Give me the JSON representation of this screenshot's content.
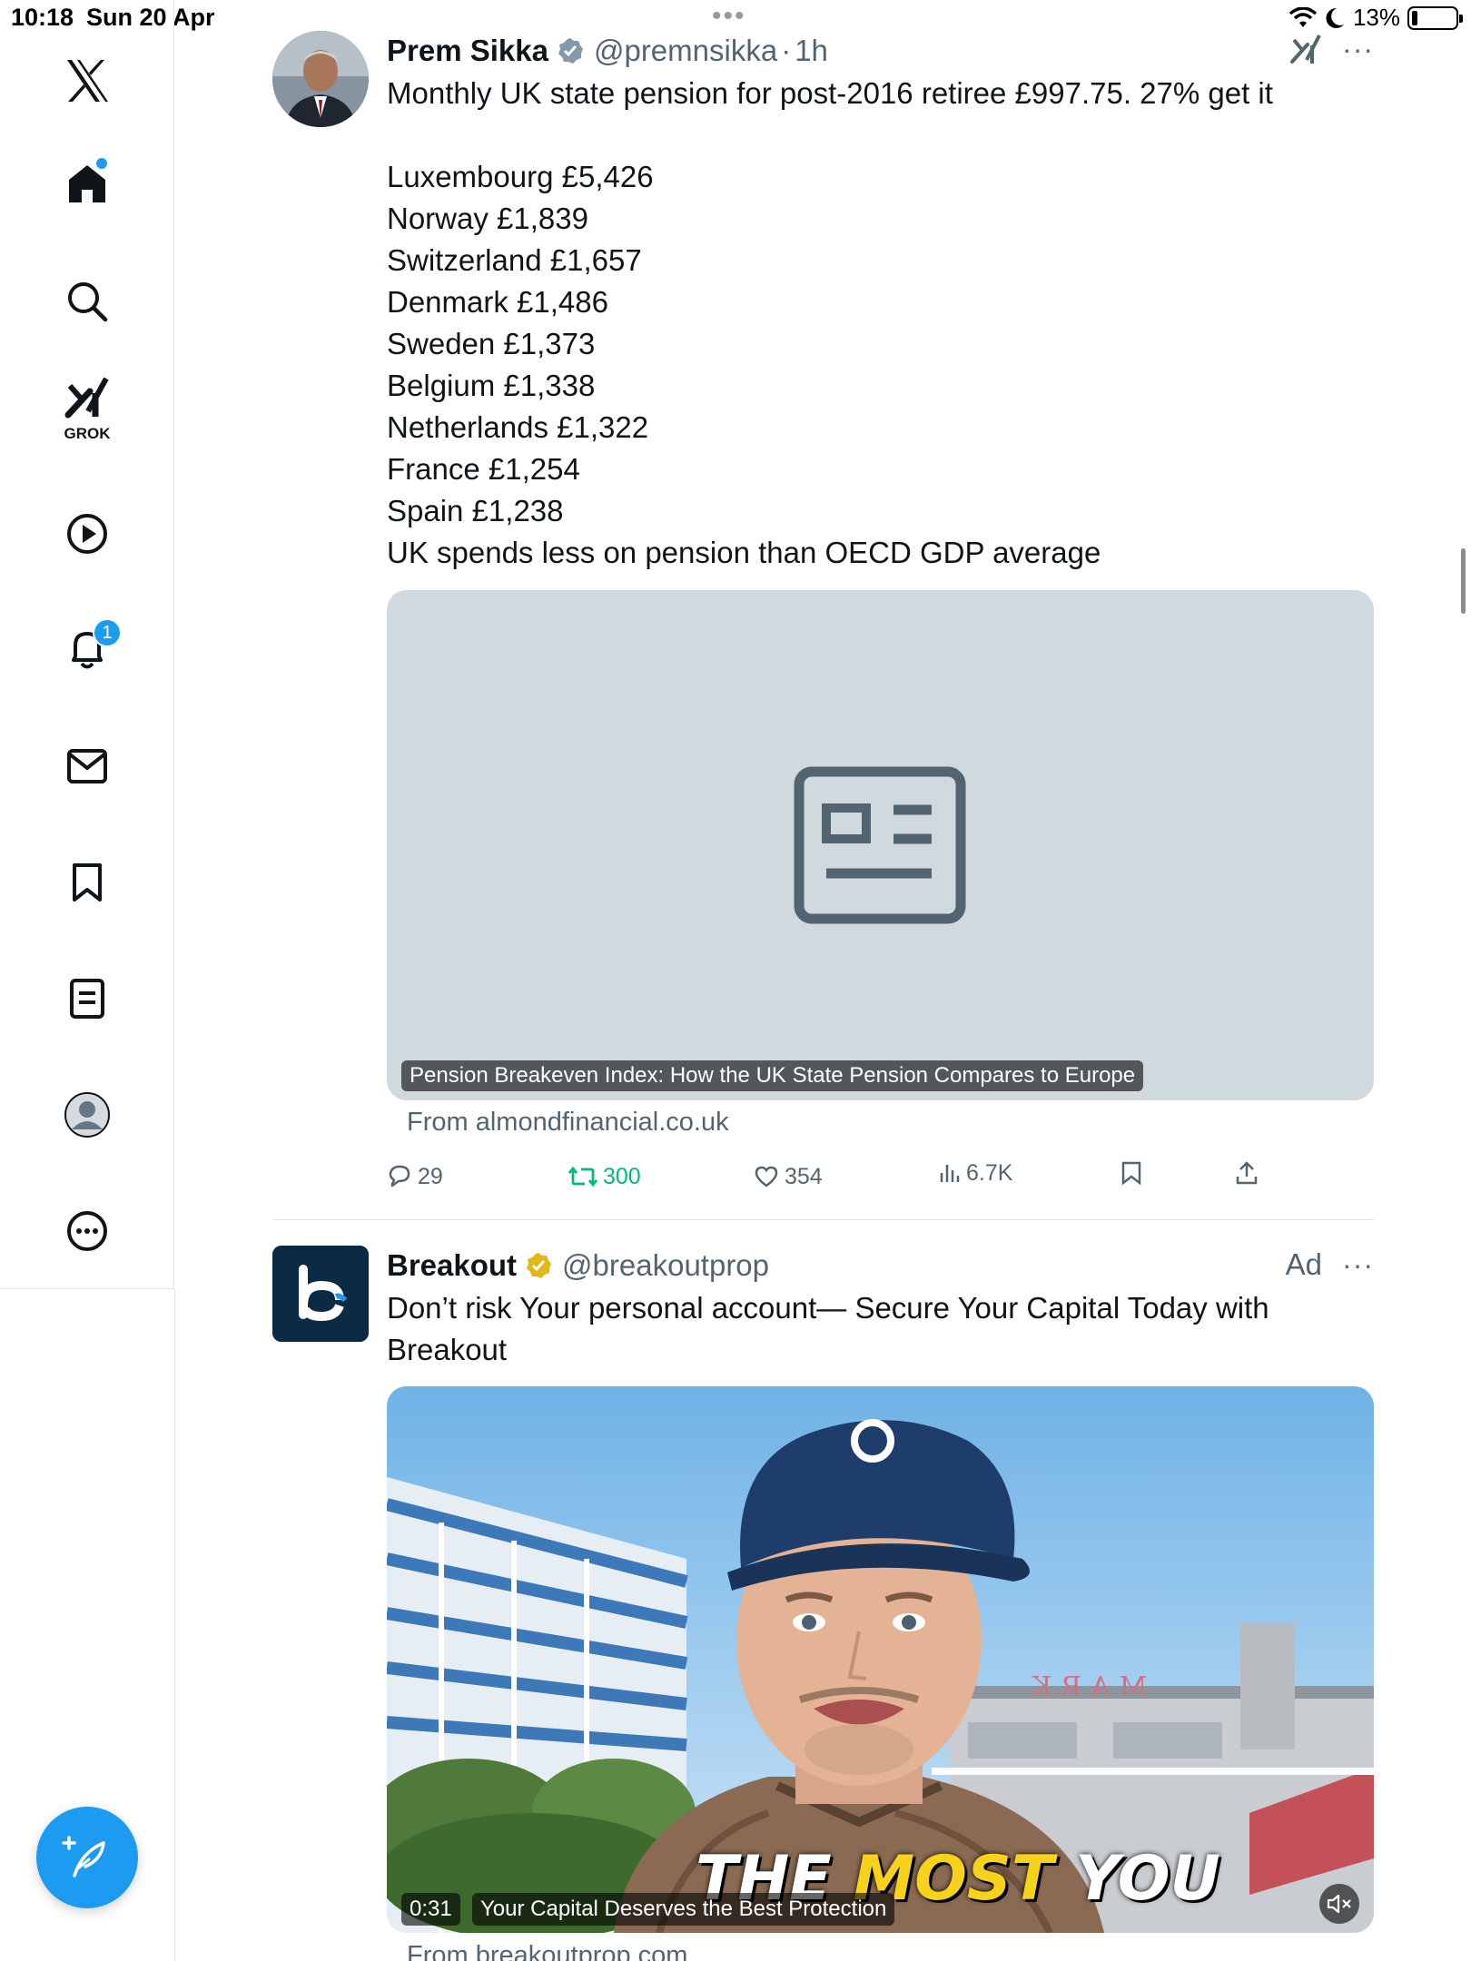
{
  "status_bar": {
    "time": "10:18",
    "date": "Sun 20 Apr",
    "battery": "13%"
  },
  "sidebar": {
    "items": [
      {
        "name": "home",
        "icon": "home-icon"
      },
      {
        "name": "search",
        "icon": "search-icon"
      },
      {
        "name": "grok",
        "icon": "grok-icon",
        "label": "GROK"
      },
      {
        "name": "video",
        "icon": "play-icon"
      },
      {
        "name": "notifications",
        "icon": "bell-icon",
        "badge": "1"
      },
      {
        "name": "messages",
        "icon": "mail-icon"
      },
      {
        "name": "bookmarks",
        "icon": "bookmark-icon"
      },
      {
        "name": "lists",
        "icon": "list-icon"
      },
      {
        "name": "profile",
        "icon": "profile-icon"
      },
      {
        "name": "more",
        "icon": "more-icon"
      }
    ],
    "accent": "#1d9bf0"
  },
  "tweets": [
    {
      "author": "Prem Sikka",
      "handle": "@premnsikka",
      "time": "1h",
      "separator": "·",
      "text": [
        "Monthly UK state pension for post-2016 retiree £997.75. 27% get it",
        "",
        "Luxembourg £5,426",
        "Norway £1,839",
        "Switzerland £1,657",
        "Denmark £1,486",
        "Sweden £1,373",
        "Belgium £1,338",
        "Netherlands £1,322",
        "France £1,254",
        "Spain £1,238",
        "UK spends less on pension than OECD GDP average"
      ],
      "card_caption": "Pension Breakeven Index: How the UK State Pension Compares to Europe",
      "card_from": "From almondfinancial.co.uk",
      "replies": "29",
      "reposts": "300",
      "likes": "354",
      "views": "6.7K"
    },
    {
      "author": "Breakout",
      "handle": "@breakoutprop",
      "ad_label": "Ad",
      "text": [
        "Don’t risk Your personal account— Secure Your Capital Today with",
        "Breakout"
      ],
      "video_duration": "0:31",
      "video_caption": "Your Capital Deserves the Best Protection",
      "video_overlay_text_1": "THE",
      "video_overlay_text_2": "MOST",
      "video_overlay_text_3": "YOU",
      "building_sign": "MARK",
      "card_from": "From breakoutprop.com"
    }
  ]
}
